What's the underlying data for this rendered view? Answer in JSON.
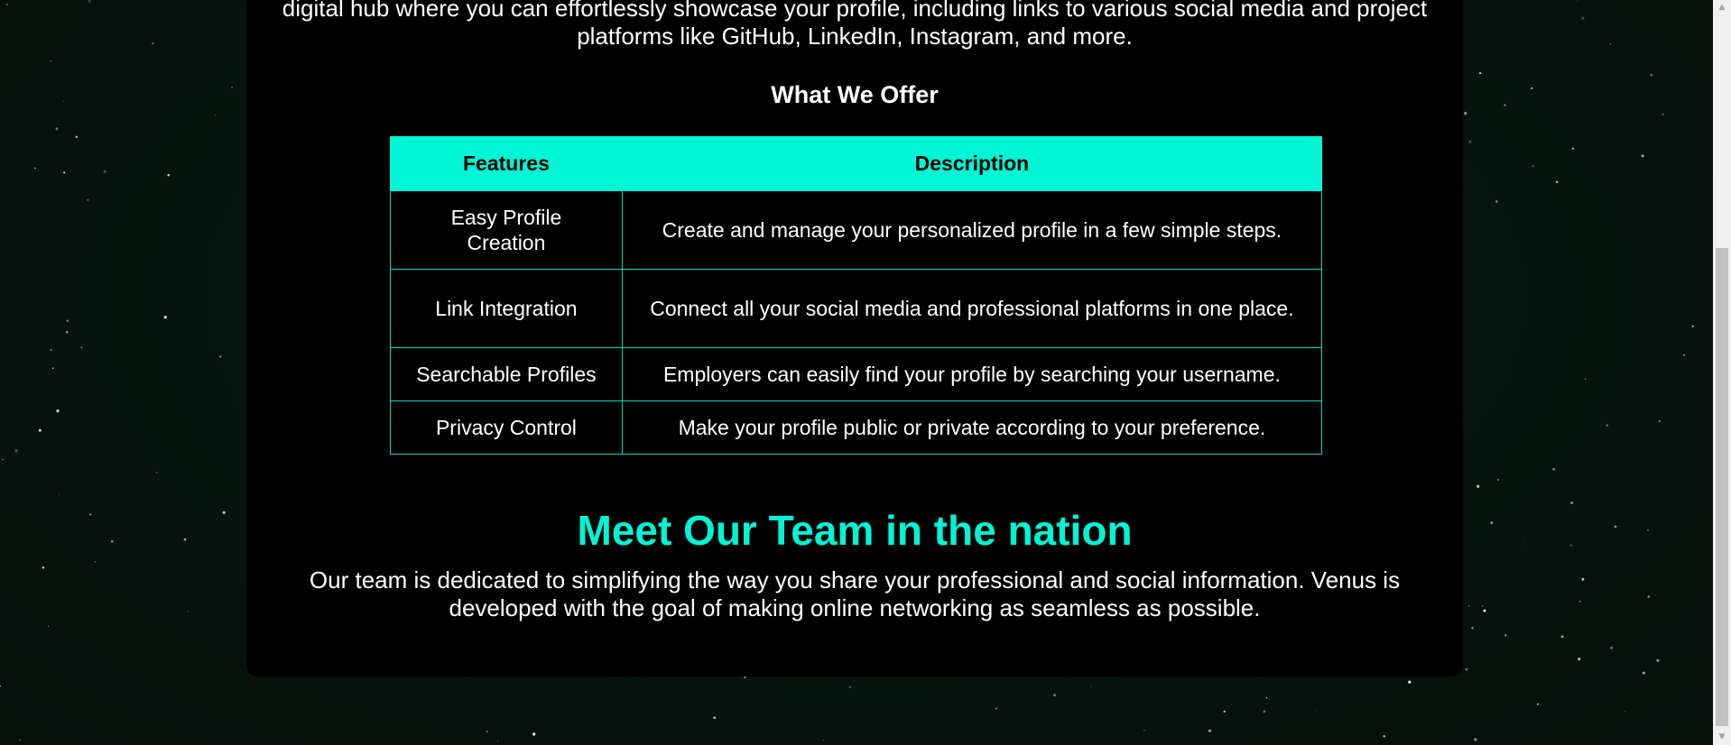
{
  "colors": {
    "accent": "#00f5d4",
    "panel": "#000000",
    "background": "#06140d",
    "text": "#ffffff"
  },
  "about": {
    "intro_text": "digital hub where you can effortlessly showcase your profile, including links to various social media and project platforms like GitHub, LinkedIn, Instagram, and more.",
    "offer_title": "What We Offer"
  },
  "features_table": {
    "headers": [
      "Features",
      "Description"
    ],
    "rows": [
      {
        "feature": "Easy Profile Creation",
        "description": "Create and manage your personalized profile in a few simple steps."
      },
      {
        "feature": "Link Integration",
        "description": "Connect all your social media and professional platforms in one place."
      },
      {
        "feature": "Searchable Profiles",
        "description": "Employers can easily find your profile by searching your username."
      },
      {
        "feature": "Privacy Control",
        "description": "Make your profile public or private according to your preference."
      }
    ]
  },
  "team": {
    "title": "Meet Our Team in the nation",
    "text": "Our team is dedicated to simplifying the way you share your professional and social information. Venus is developed with the goal of making online networking as seamless as possible."
  },
  "scrollbar": {
    "up_icon": "triangle-up",
    "down_icon": "triangle-down"
  }
}
